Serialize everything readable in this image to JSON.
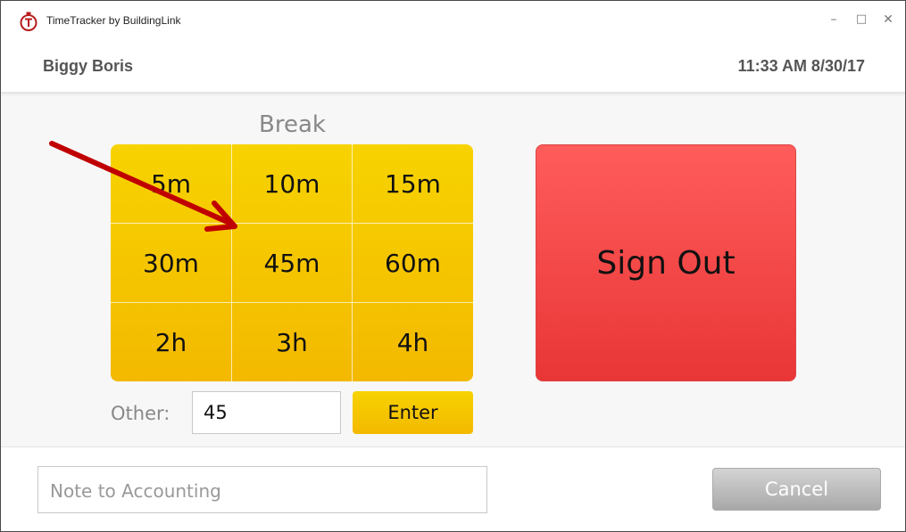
{
  "window": {
    "title": "TimeTracker by BuildingLink",
    "app_icon": "stopwatch-icon",
    "controls": {
      "minimize": "–",
      "maximize": "□",
      "close": "✕"
    }
  },
  "header": {
    "user_name": "Biggy Boris",
    "datetime": "11:33 AM 8/30/17"
  },
  "break_panel": {
    "label": "Break",
    "options": [
      "5m",
      "10m",
      "15m",
      "30m",
      "45m",
      "60m",
      "2h",
      "3h",
      "4h"
    ],
    "other_label": "Other:",
    "other_value": "45",
    "enter_label": "Enter"
  },
  "sign_out_label": "Sign Out",
  "footer": {
    "note_placeholder": "Note to Accounting",
    "cancel_label": "Cancel"
  },
  "colors": {
    "break_yellow": "#f5c800",
    "sign_out_red": "#f04646",
    "annotation_arrow": "#c00000",
    "cancel_gray": "#bdbdbd"
  }
}
